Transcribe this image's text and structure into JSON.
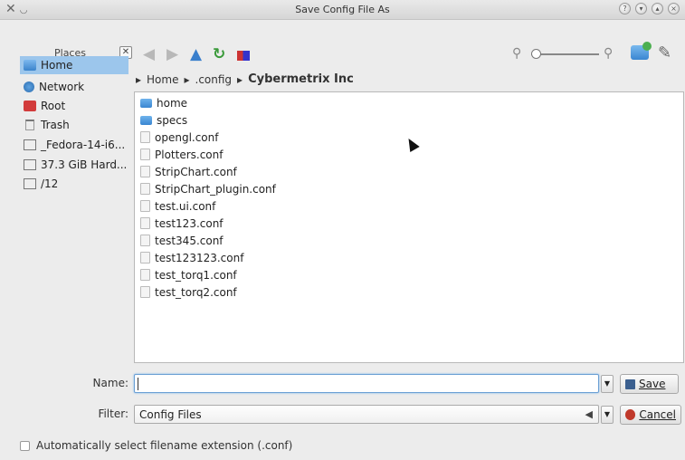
{
  "window": {
    "title": "Save Config File As"
  },
  "places": {
    "header": "Places",
    "items": [
      {
        "label": "Home",
        "icon": "home-icon",
        "selected": true
      },
      {
        "label": "Network",
        "icon": "network-icon"
      },
      {
        "label": "Root",
        "icon": "root-icon"
      },
      {
        "label": "Trash",
        "icon": "trash-icon"
      },
      {
        "label": "_Fedora-14-i6...",
        "icon": "drive-icon"
      },
      {
        "label": "37.3 GiB Hard...",
        "icon": "drive-icon"
      },
      {
        "label": "/12",
        "icon": "drive-icon"
      }
    ]
  },
  "breadcrumb": {
    "items": [
      "Home",
      ".config",
      "Cybermetrix Inc"
    ]
  },
  "files": [
    {
      "name": "home",
      "type": "folder"
    },
    {
      "name": "specs",
      "type": "folder"
    },
    {
      "name": "opengl.conf",
      "type": "file"
    },
    {
      "name": "Plotters.conf",
      "type": "file"
    },
    {
      "name": "StripChart.conf",
      "type": "file"
    },
    {
      "name": "StripChart_plugin.conf",
      "type": "file"
    },
    {
      "name": "test.ui.conf",
      "type": "file"
    },
    {
      "name": "test123.conf",
      "type": "file"
    },
    {
      "name": "test345.conf",
      "type": "file"
    },
    {
      "name": "test123123.conf",
      "type": "file"
    },
    {
      "name": "test_torq1.conf",
      "type": "file"
    },
    {
      "name": "test_torq2.conf",
      "type": "file"
    }
  ],
  "form": {
    "name_label": "Name:",
    "name_value": "",
    "filter_label": "Filter:",
    "filter_value": "Config Files",
    "save_label": "Save",
    "cancel_label": "Cancel",
    "auto_ext_label": "Automatically select filename extension (.conf)",
    "auto_ext_checked": false
  },
  "colors": {
    "selection": "#9cc6ec",
    "folder": "#3a86d1",
    "accent_green": "#3a9a3a",
    "cancel_red": "#c0392b"
  }
}
